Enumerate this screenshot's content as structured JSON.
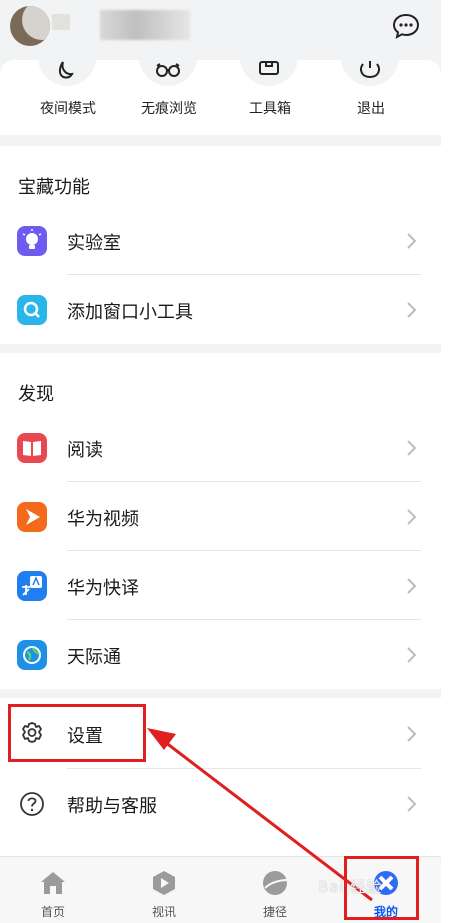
{
  "quick_tools": [
    {
      "label": "夜间模式",
      "icon": "moon-icon"
    },
    {
      "label": "无痕浏览",
      "icon": "glasses-icon"
    },
    {
      "label": "工具箱",
      "icon": "toolbox-icon"
    },
    {
      "label": "退出",
      "icon": "power-icon"
    }
  ],
  "treasure": {
    "title": "宝藏功能",
    "items": [
      {
        "label": "实验室",
        "icon": "lightbulb-icon",
        "color": "#6e5cf0"
      },
      {
        "label": "添加窗口小工具",
        "icon": "search-widget-icon",
        "color": "#2ab6e8"
      }
    ]
  },
  "discover": {
    "title": "发现",
    "items": [
      {
        "label": "阅读",
        "icon": "book-icon",
        "color": "#e8484f"
      },
      {
        "label": "华为视频",
        "icon": "video-play-icon",
        "color": "#f36a1c"
      },
      {
        "label": "华为快译",
        "icon": "translate-icon",
        "color": "#1f7ff0"
      },
      {
        "label": "天际通",
        "icon": "globe-icon",
        "color": "#1e90e6"
      }
    ]
  },
  "misc": {
    "items": [
      {
        "label": "设置",
        "icon": "gear-icon"
      },
      {
        "label": "帮助与客服",
        "icon": "help-icon"
      }
    ]
  },
  "bottom_nav": [
    {
      "label": "首页",
      "icon": "home-icon",
      "active": false
    },
    {
      "label": "视讯",
      "icon": "video-icon",
      "active": false
    },
    {
      "label": "捷径",
      "icon": "shortcut-icon",
      "active": false
    },
    {
      "label": "我的",
      "icon": "profile-icon",
      "active": true
    }
  ],
  "colors": {
    "accent": "#0a59f7",
    "annotation": "#e02020"
  },
  "watermark": "Bai 经验"
}
